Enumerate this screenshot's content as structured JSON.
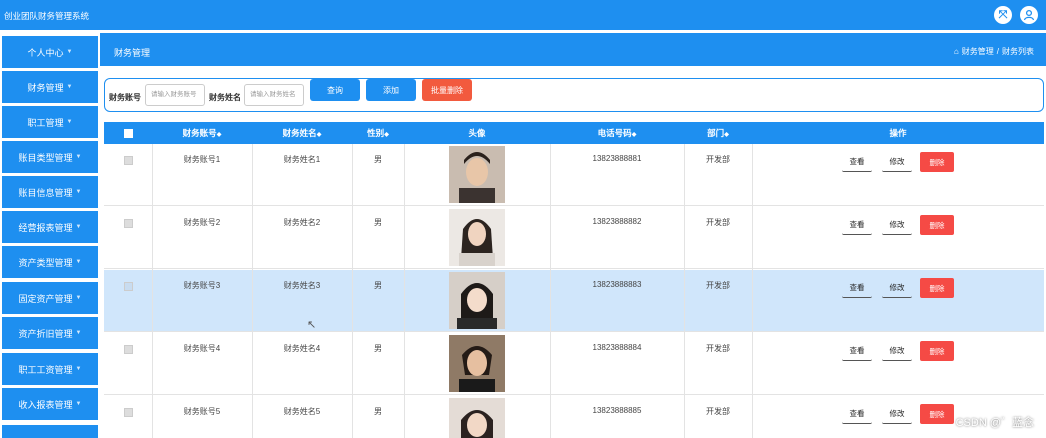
{
  "app": {
    "title": "创业团队财务管理系统"
  },
  "sidebar": {
    "items": [
      {
        "label": "个人中心"
      },
      {
        "label": "财务管理"
      },
      {
        "label": "职工管理"
      },
      {
        "label": "账目类型管理"
      },
      {
        "label": "账目信息管理"
      },
      {
        "label": "经营报表管理"
      },
      {
        "label": "资产类型管理"
      },
      {
        "label": "固定资产管理"
      },
      {
        "label": "资产折旧管理"
      },
      {
        "label": "职工工资管理"
      },
      {
        "label": "收入报表管理"
      }
    ]
  },
  "header": {
    "section_title": "财务管理",
    "breadcrumbs": [
      "财务管理",
      "财务列表"
    ],
    "separator": "/"
  },
  "search": {
    "account_label": "财务账号",
    "account_placeholder": "请输入财务账号",
    "name_label": "财务姓名",
    "name_placeholder": "请输入财务姓名",
    "query_button": "查询",
    "add_button": "添加",
    "batch_delete_button": "批量删除"
  },
  "table": {
    "columns": [
      "财务账号",
      "财务姓名",
      "性别",
      "头像",
      "电话号码",
      "部门",
      "操作"
    ],
    "sort_mark": "◆",
    "actions": {
      "view": "查看",
      "edit": "修改",
      "delete": "删除"
    },
    "rows": [
      {
        "account": "财务账号1",
        "name": "财务姓名1",
        "gender": "男",
        "phone": "13823888881",
        "dept": "开发部"
      },
      {
        "account": "财务账号2",
        "name": "财务姓名2",
        "gender": "男",
        "phone": "13823888882",
        "dept": "开发部"
      },
      {
        "account": "财务账号3",
        "name": "财务姓名3",
        "gender": "男",
        "phone": "13823888883",
        "dept": "开发部"
      },
      {
        "account": "财务账号4",
        "name": "财务姓名4",
        "gender": "男",
        "phone": "13823888884",
        "dept": "开发部"
      },
      {
        "account": "财务账号5",
        "name": "财务姓名5",
        "gender": "男",
        "phone": "13823888885",
        "dept": "开发部"
      }
    ]
  },
  "watermark": "CSDN @゛蓝念",
  "colors": {
    "primary": "#1e8ff0",
    "danger": "#f25a3e",
    "highlight_row": "#d0e6fb"
  }
}
